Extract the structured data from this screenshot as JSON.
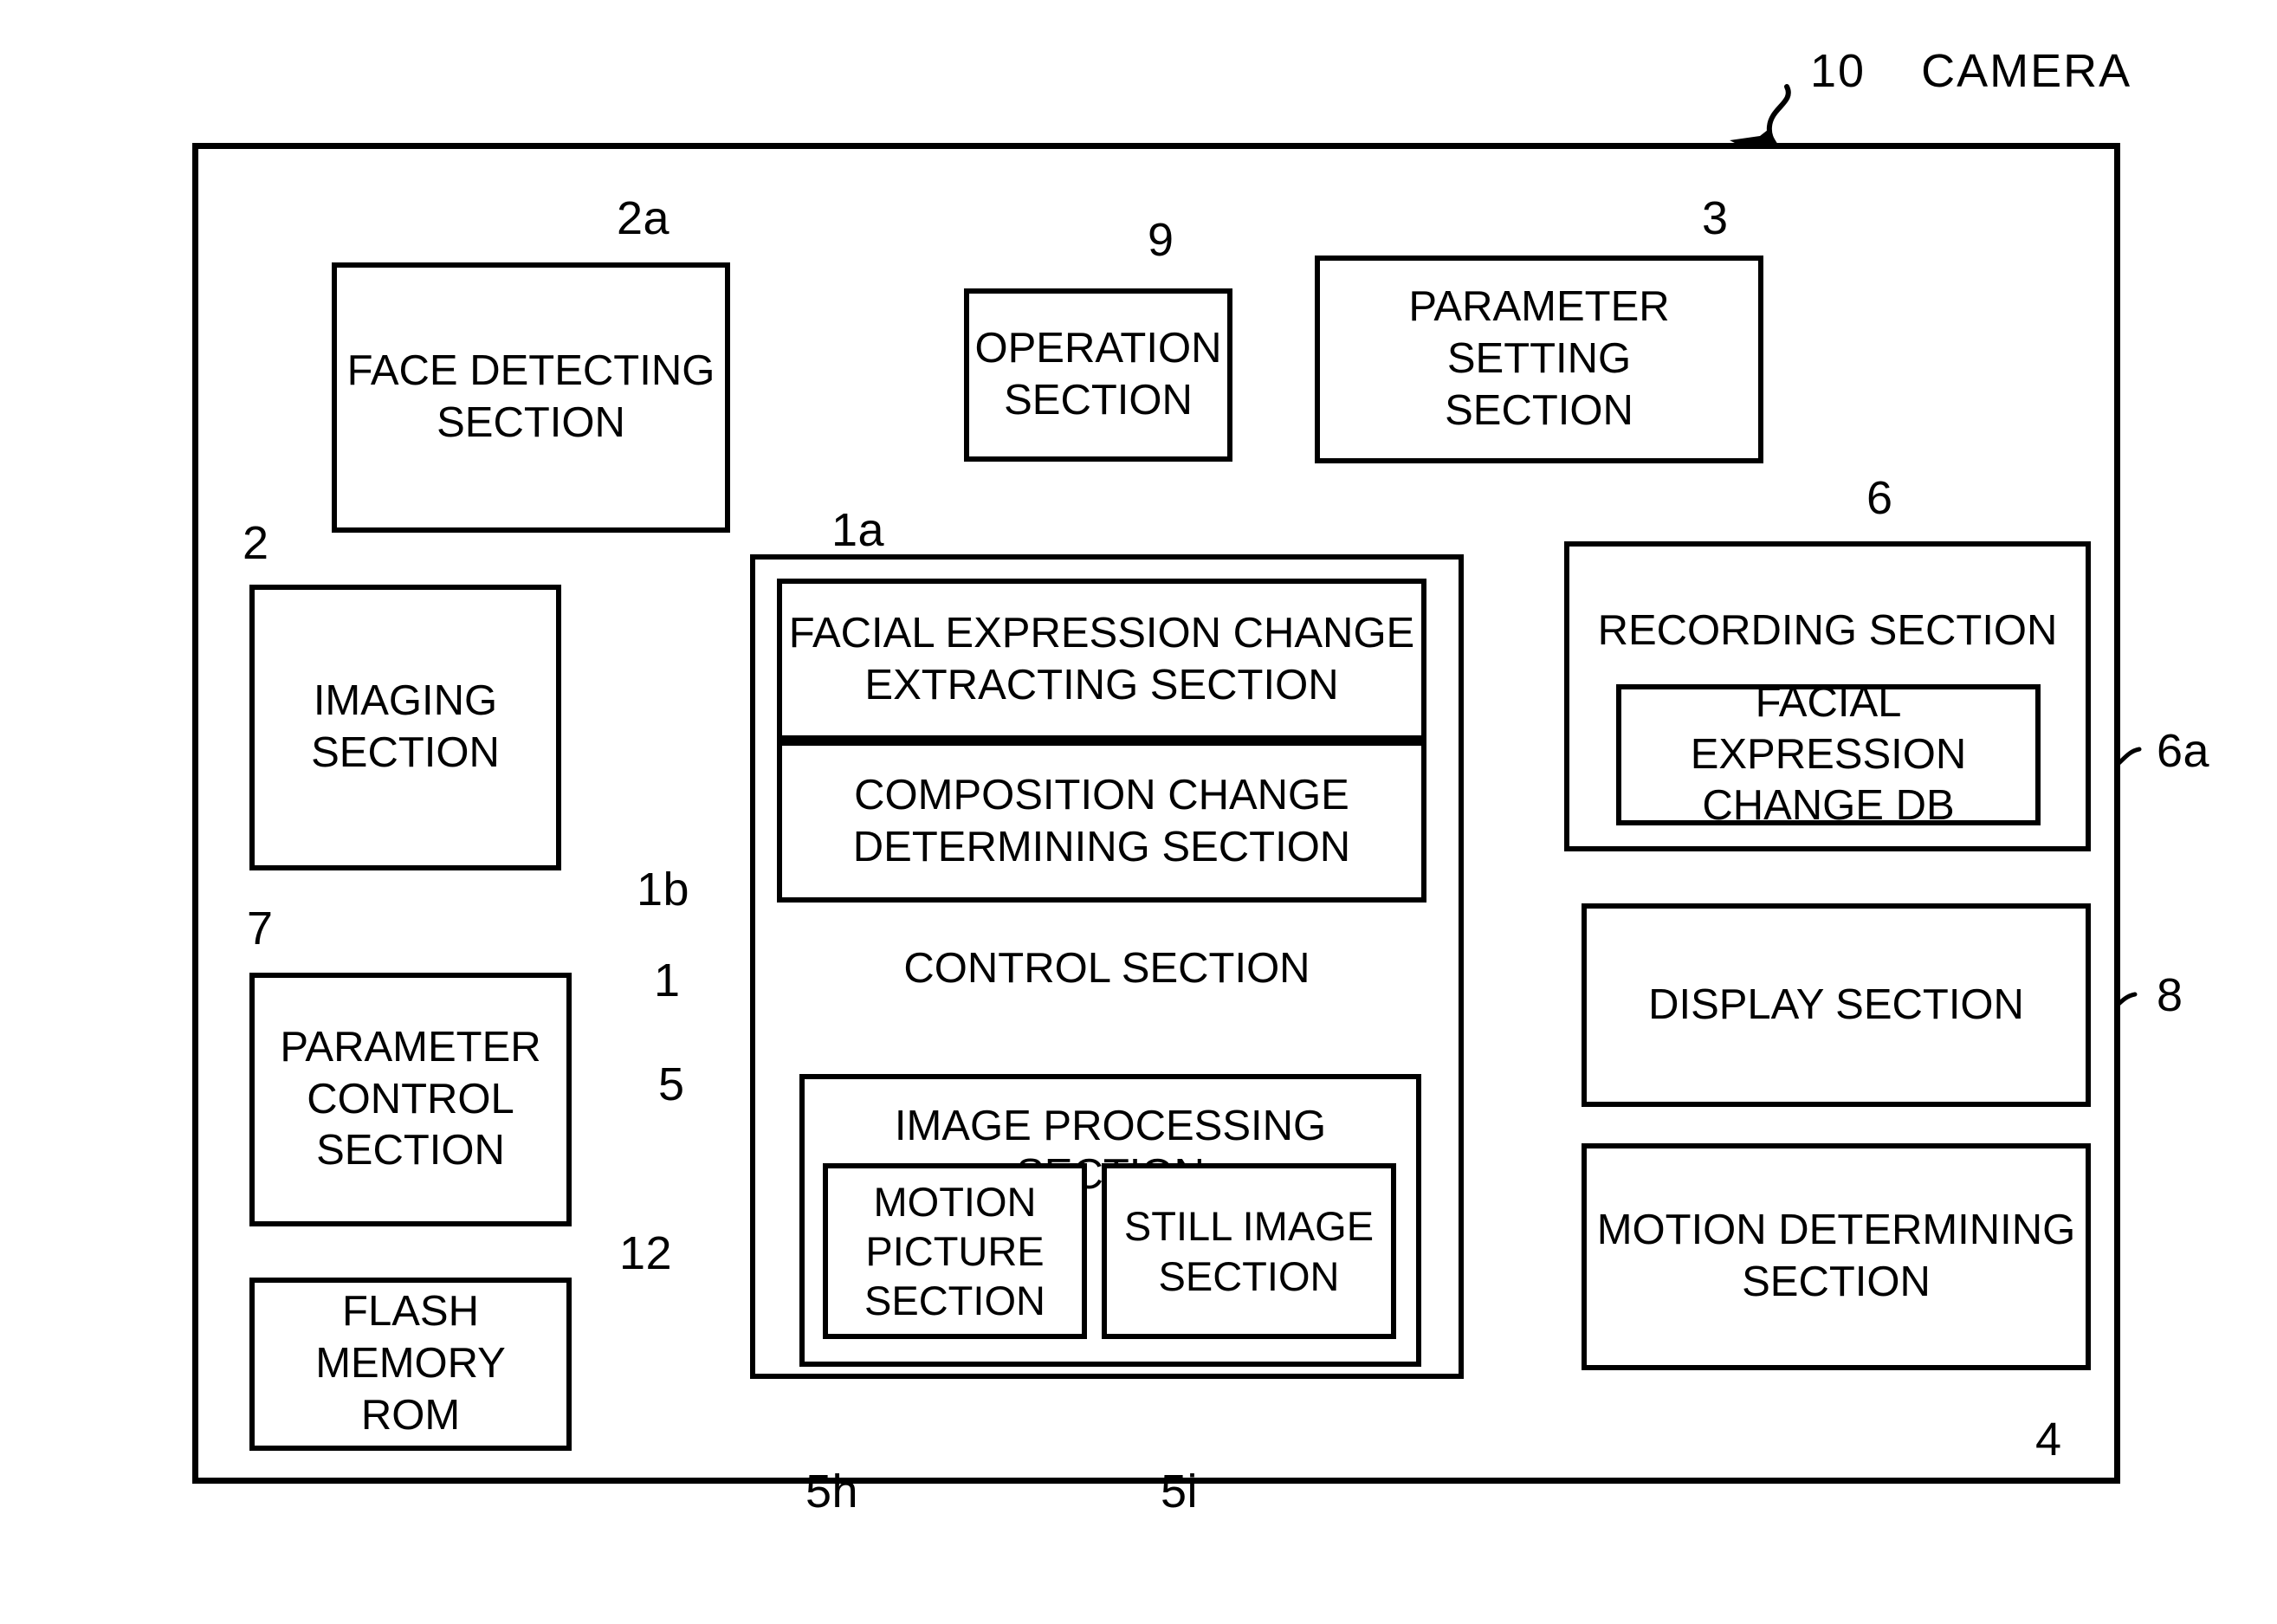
{
  "figure": {
    "title_ref": "10",
    "title_text": "CAMERA"
  },
  "blocks": {
    "face_detecting": {
      "label": "FACE DETECTING\nSECTION",
      "ref": "2a"
    },
    "imaging": {
      "label": "IMAGING\nSECTION",
      "ref": "2"
    },
    "parameter_control": {
      "label": "PARAMETER\nCONTROL\nSECTION",
      "ref": "7"
    },
    "flash_memory": {
      "label": "FLASH MEMORY\nROM",
      "ref": "12"
    },
    "operation": {
      "label": "OPERATION\nSECTION",
      "ref": "9"
    },
    "parameter_setting": {
      "label": "PARAMETER SETTING\nSECTION",
      "ref": "3"
    },
    "control": {
      "label": "CONTROL SECTION",
      "ref": "1"
    },
    "facial_expression_change_extracting": {
      "label": "FACIAL EXPRESSION CHANGE\nEXTRACTING SECTION",
      "ref": "1a"
    },
    "composition_change_determining": {
      "label": "COMPOSITION CHANGE\nDETERMINING SECTION",
      "ref": "1b"
    },
    "image_processing": {
      "label": "IMAGE PROCESSING SECTION",
      "ref": "5"
    },
    "motion_picture": {
      "label": "MOTION\nPICTURE\nSECTION",
      "ref": "5h"
    },
    "still_image": {
      "label": "STILL IMAGE\nSECTION",
      "ref": "5i"
    },
    "recording": {
      "label": "RECORDING SECTION",
      "ref": "6"
    },
    "facial_expression_change_db": {
      "label": "FACIAL EXPRESSION\nCHANGE DB",
      "ref": "6a"
    },
    "display": {
      "label": "DISPLAY SECTION",
      "ref": "8"
    },
    "motion_determining": {
      "label": "MOTION DETERMINING\nSECTION",
      "ref": "4"
    }
  },
  "colors": {
    "line": "#000000",
    "background": "#ffffff"
  }
}
